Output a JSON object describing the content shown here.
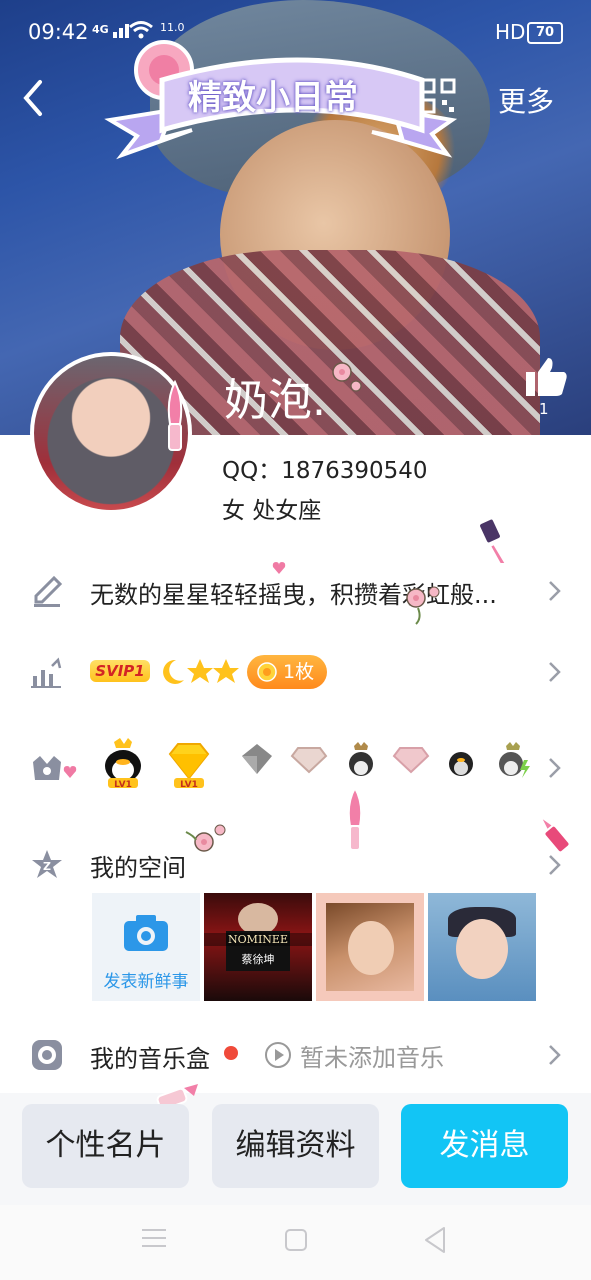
{
  "status_bar": {
    "time": "09:42",
    "network": "4G",
    "speed": "11.0",
    "hd": "HD",
    "battery": "70"
  },
  "nav": {
    "banner_text": "精致小日常",
    "more_label": "更多"
  },
  "profile": {
    "nickname": "奶泡.",
    "like_count": "1",
    "qq_line": "QQ：1876390540",
    "gender_line": "女  处女座"
  },
  "rows": {
    "signature": "无数的星星轻轻摇曳，积攒着彩虹般...",
    "level": {
      "svip": "SVIP1",
      "coin": "1枚"
    },
    "space_label": "我的空间",
    "post_label": "发表新鲜事",
    "music_label": "我的音乐盒",
    "music_empty": "暂未添加音乐"
  },
  "thumbs": {
    "nominee_title": "NOMINEE",
    "nominee_name": "蔡徐坤"
  },
  "medals": [
    "LV1",
    "LV1"
  ],
  "actions": {
    "card": "个性名片",
    "edit": "编辑资料",
    "message": "发消息"
  },
  "colors": {
    "primary": "#12c5f5",
    "svip": "#ffc21c",
    "coin": "#ff8a1c",
    "dot": "#f04a3a"
  }
}
